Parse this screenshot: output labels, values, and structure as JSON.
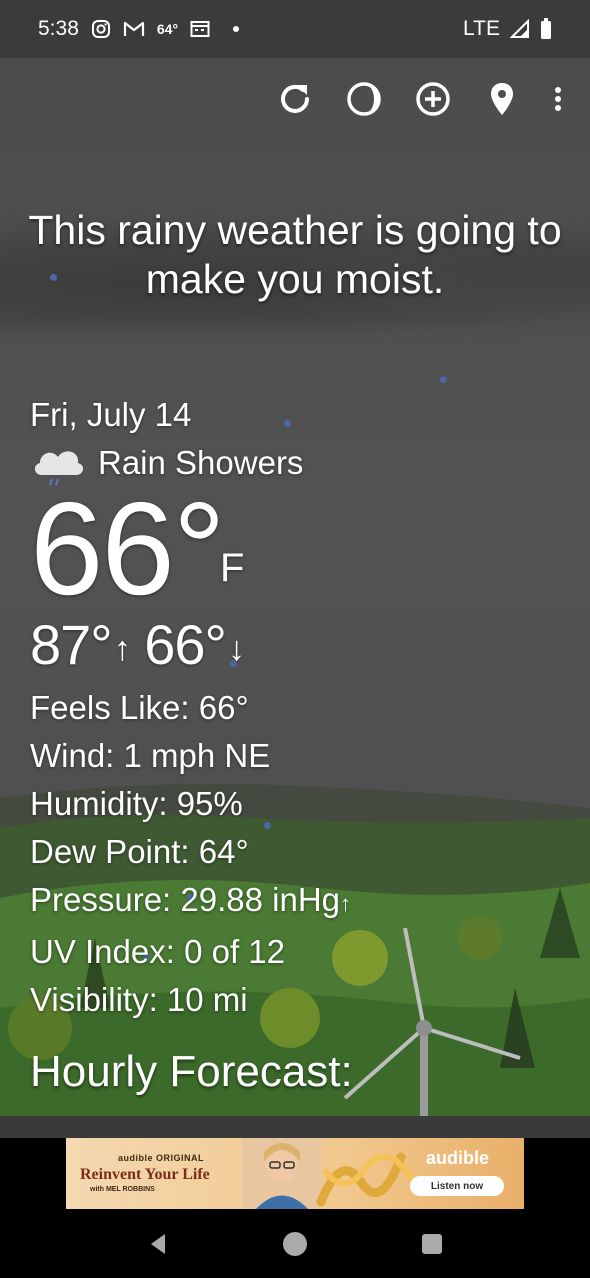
{
  "status_bar": {
    "time": "5:38",
    "temp_notification": "64°",
    "network": "LTE",
    "icons": [
      "instagram-icon",
      "gmail-icon",
      "calendar-icon",
      "dot-icon",
      "signal-icon",
      "battery-icon"
    ]
  },
  "toolbar": {
    "icons": [
      "refresh-icon",
      "moon-phase-icon",
      "add-location-icon",
      "location-pin-icon",
      "more-vert-icon"
    ]
  },
  "tagline": "This rainy weather is going to make you moist.",
  "current": {
    "date": "Fri, July 14",
    "condition": "Rain Showers",
    "condition_icon": "rain-cloud-icon",
    "temperature": "66°",
    "unit": "F",
    "high": "87°",
    "low": "66°"
  },
  "details": {
    "feels_like": "Feels Like:  66°",
    "wind": "Wind:  1 mph NE",
    "humidity": "Humidity:  95%",
    "dew_point": "Dew Point:  64°",
    "pressure": "Pressure:  29.88 inHg",
    "uv_index": "UV Index:  0 of 12",
    "visibility": "Visibility:  10 mi"
  },
  "hourly_heading": "Hourly Forecast:",
  "ad": {
    "small_label": "audible ORIGINAL",
    "title": "Reinvent Your Life",
    "author": "with MEL ROBBINS",
    "brand": "audible",
    "cta": "Listen now"
  },
  "colors": {
    "sky": "#505050",
    "status_bar": "#3b3b3b",
    "raindrop": "#4b67a8",
    "grass": "#3e6b2a"
  }
}
